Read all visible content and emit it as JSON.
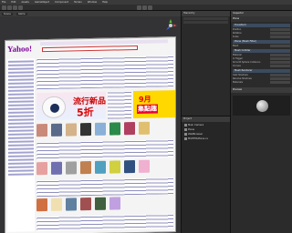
{
  "menu": [
    "File",
    "Edit",
    "Assets",
    "GameObject",
    "Component",
    "Terrain",
    "Window",
    "Help"
  ],
  "scene": {
    "tabs": [
      "Scene",
      "Game"
    ],
    "logo_text": "Yahoo!",
    "banner_main": "流行新品",
    "banner_discount": "5折",
    "banner_side_title": "9月",
    "banner_side_sub": "集點趣"
  },
  "hierarchy": {
    "title": "Hierarchy"
  },
  "project": {
    "title": "Project",
    "files": [
      "Main Camera",
      "Plane",
      "WebBrowser",
      "MSHTMLPlane.cs"
    ]
  },
  "inspector": {
    "title": "Inspector",
    "object_name": "Plane",
    "components": [
      {
        "title": "Transform",
        "props": [
          "Position",
          "Rotation",
          "Scale"
        ]
      },
      {
        "title": "Plane (Mesh Filter)",
        "props": [
          "Mesh"
        ]
      },
      {
        "title": "Mesh Collider",
        "props": [
          "Material",
          "Is Trigger",
          "Smooth Sphere Collisions",
          "Convex"
        ]
      },
      {
        "title": "Mesh Renderer",
        "props": [
          "Cast Shadows",
          "Receive Shadows",
          "Materials"
        ]
      }
    ],
    "preview_label": "Preview"
  },
  "colors": {
    "accent": "#3c4b5e",
    "banner_yellow": "#ffd800",
    "logo_purple": "#7b0099"
  }
}
